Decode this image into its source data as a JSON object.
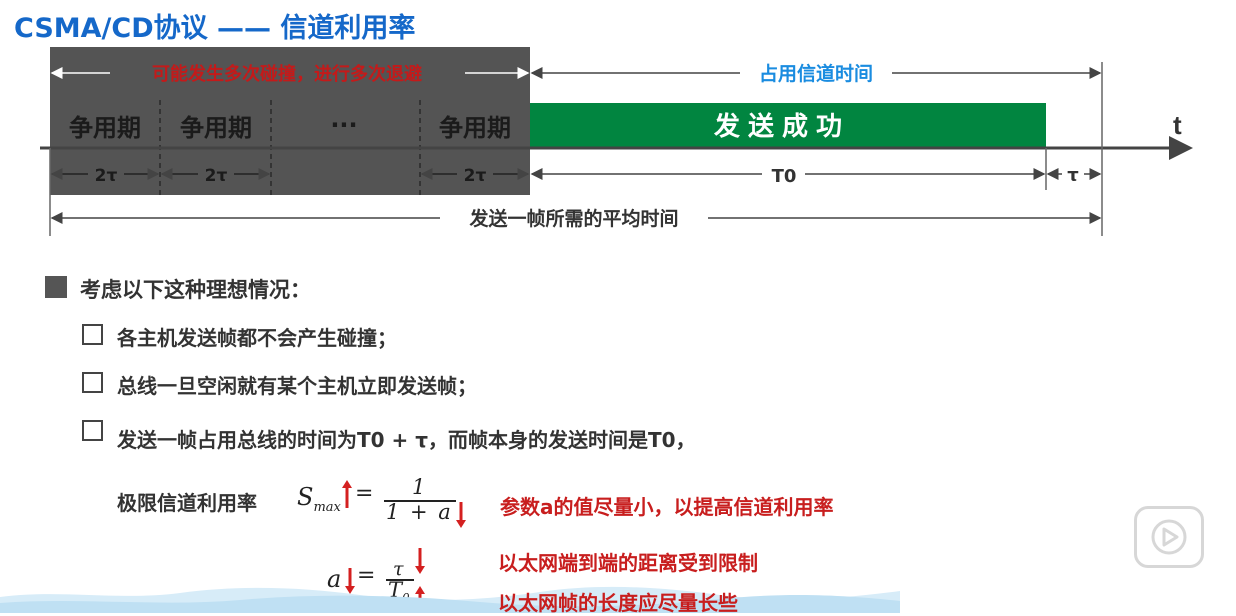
{
  "title": "CSMA/CD协议 —— 信道利用率",
  "diagram": {
    "collision_label": "可能发生多次碰撞，进行多次退避",
    "occupy_label": "占用信道时间",
    "contention_label": "争用期",
    "ellipsis": "···",
    "success_label": "发送成功",
    "t_axis": "t",
    "two_tau": "2τ",
    "T0": "T0",
    "tau": "τ",
    "avg_time_label": "发送一帧所需的平均时间"
  },
  "content": {
    "heading": "考虑以下这种理想情况：",
    "items": [
      "各主机发送帧都不会产生碰撞；",
      "总线一旦空闲就有某个主机立即发送帧；",
      "发送一帧占用总线的时间为T0 + τ，而帧本身的发送时间是T0，"
    ],
    "limit_label": "极限信道利用率",
    "formula": {
      "S": "S",
      "max": "max",
      "equals": "=",
      "numerator": "1",
      "denominator": "1 + a",
      "a": "a",
      "tau": "τ",
      "T": "T",
      "zero": "0"
    },
    "note_a_small": "参数a的值尽量小，以提高信道利用率",
    "note_distance": "以太网端到端的距离受到限制",
    "note_frame": "以太网帧的长度应尽量长些"
  },
  "colors": {
    "title": "#1568c9",
    "gray_block": "#545454",
    "green_block": "#018540",
    "red": "#c81e1e",
    "blue_label": "#1a8ce0"
  }
}
